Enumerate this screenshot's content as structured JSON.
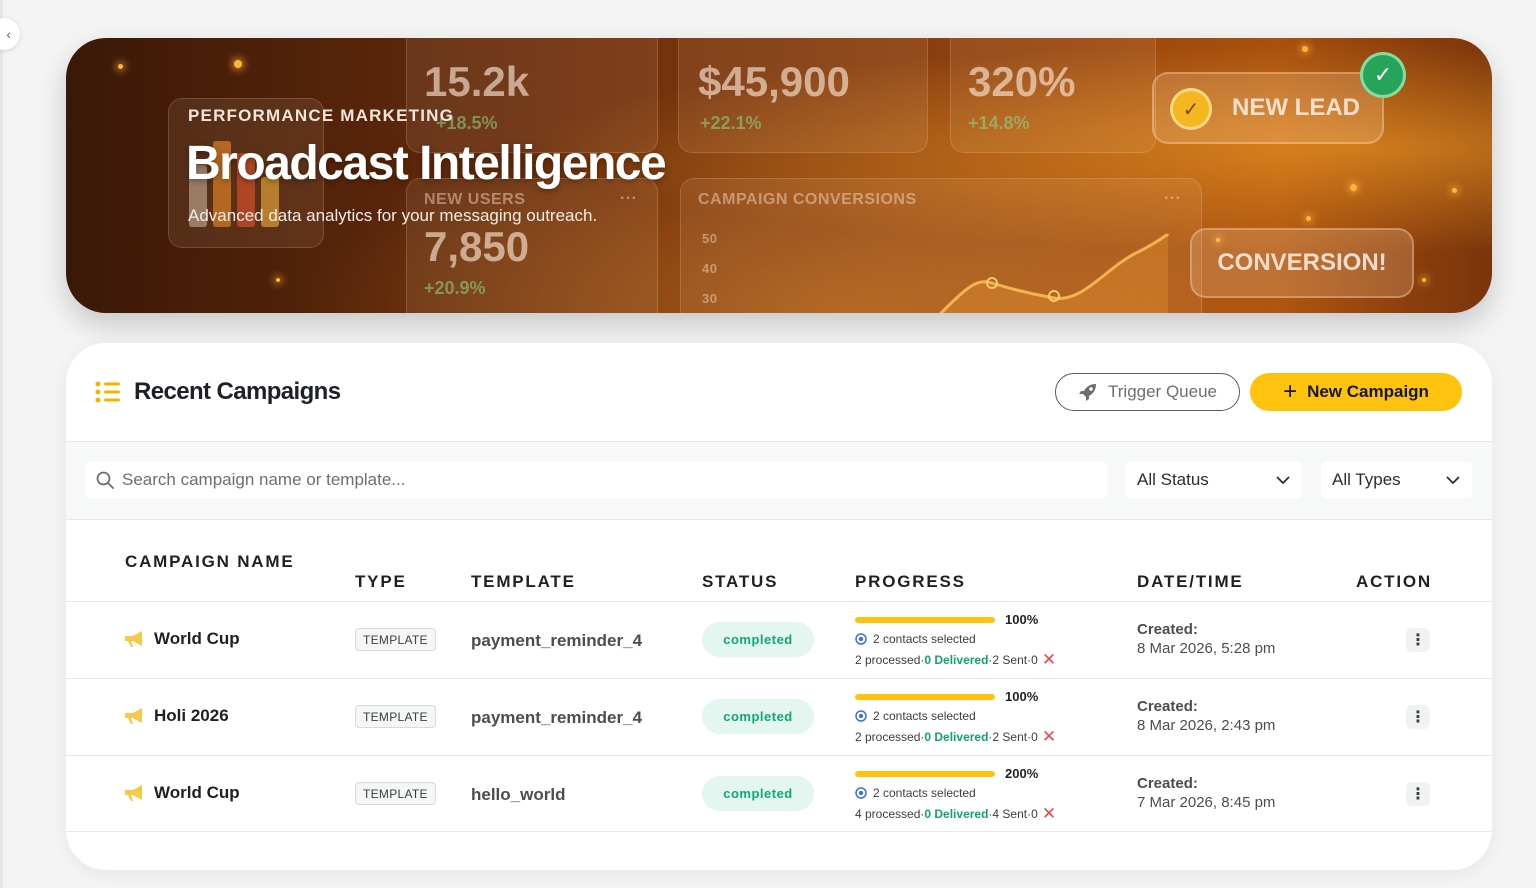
{
  "hero": {
    "kicker": "PERFORMANCE MARKETING",
    "title": "Broadcast Intelligence",
    "subtitle": "Advanced data analytics for your messaging outreach.",
    "bg_stats": [
      {
        "value": "15.2k",
        "change": "+18.5%"
      },
      {
        "value": "$45,900",
        "change": "+22.1%"
      },
      {
        "value": "320%",
        "change": "+14.8%"
      },
      {
        "caption": "NEW USERS",
        "value": "7,850",
        "change": "+20.9%"
      }
    ],
    "conversions_caption": "CAMPAIGN CONVERSIONS",
    "axis_ticks": [
      "50",
      "40",
      "30"
    ],
    "new_lead_label": "NEW LEAD",
    "conversion_label": "CONVERSION!",
    "ellipsis": "···"
  },
  "campaigns": {
    "title": "Recent Campaigns",
    "trigger_label": "Trigger Queue",
    "new_label": "New Campaign",
    "search_placeholder": "Search campaign name or template...",
    "status_filter": "All Status",
    "type_filter": "All Types",
    "columns": {
      "name": "CAMPAIGN NAME",
      "type": "TYPE",
      "template": "TEMPLATE",
      "status": "STATUS",
      "progress": "PROGRESS",
      "datetime": "DATE/TIME",
      "action": "ACTION"
    },
    "rows": [
      {
        "name": "World Cup",
        "type": "TEMPLATE",
        "template": "payment_reminder_4",
        "status": "completed",
        "percent": "100%",
        "progress_fraction": 1.0,
        "selected": "2 contacts selected",
        "processed": "2 processed",
        "delivered": "0 Delivered",
        "sent": "2 Sent",
        "failed": "0",
        "created_label": "Created:",
        "created": "8 Mar 2026, 5:28 pm"
      },
      {
        "name": "Holi 2026",
        "type": "TEMPLATE",
        "template": "payment_reminder_4",
        "status": "completed",
        "percent": "100%",
        "progress_fraction": 1.0,
        "selected": "2 contacts selected",
        "processed": "2 processed",
        "delivered": "0 Delivered",
        "sent": "2 Sent",
        "failed": "0",
        "created_label": "Created:",
        "created": "8 Mar 2026, 2:43 pm"
      },
      {
        "name": "World Cup",
        "type": "TEMPLATE",
        "template": "hello_world",
        "status": "completed",
        "percent": "200%",
        "progress_fraction": 1.0,
        "selected": "2 contacts selected",
        "processed": "4 processed",
        "delivered": "0 Delivered",
        "sent": "4 Sent",
        "failed": "0",
        "created_label": "Created:",
        "created": "7 Mar 2026, 8:45 pm"
      }
    ],
    "separator": " · "
  },
  "colors": {
    "accent": "#ffc20e",
    "status_bg": "#e3f7f0",
    "status_text": "#12a679",
    "delivered": "#12a36b",
    "failed": "#ef4452"
  }
}
